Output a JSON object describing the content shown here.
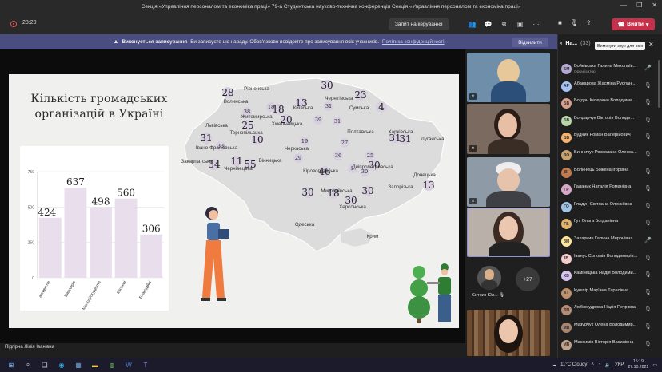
{
  "window": {
    "title": "Секція «Управління персоналом та економіка праці» 79-а Студентська науково-технічна конференція Секція «Управління персоналом та економіка праці»"
  },
  "meeting": {
    "timer": "28:20",
    "request_control_label": "Запит на керування",
    "leave_label": "Вийти"
  },
  "banner": {
    "bold": "Виконується записування",
    "text": "Ви записуєте цю нараду. Обов'язково повідомте про записування всіх учасників.",
    "link": "Політика конфіденційності",
    "dismiss_label": "Відхилити"
  },
  "slide": {
    "title": "Кількість громадських організацій в Україні"
  },
  "chart_data": {
    "type": "bar",
    "categories": [
      "активістів",
      "Школярів",
      "Молоді/студентів",
      "Місцеві",
      "Благодійні"
    ],
    "values": [
      424,
      637,
      498,
      560,
      306
    ],
    "ylim": [
      0,
      750
    ],
    "yticks": [
      "0",
      "250",
      "500",
      "750"
    ],
    "colors": {
      "bar": "#e8deec",
      "axis": "#555555"
    }
  },
  "map": {
    "regions": [
      {
        "name": "Рівненська",
        "value": ""
      },
      {
        "name": "Волинська",
        "value": "28"
      },
      {
        "name": "Чернігівська",
        "value": "30"
      },
      {
        "name": "Сумська",
        "value": "23"
      },
      {
        "name": "Житомирська",
        "value": "18"
      },
      {
        "name": "Київська",
        "value": "13"
      },
      {
        "name": "Львівська",
        "value": "31"
      },
      {
        "name": "Тернопільська",
        "value": "25"
      },
      {
        "name": "Хмельницька",
        "value": "20"
      },
      {
        "name": "Полтавська",
        "value": "31"
      },
      {
        "name": "Харківська",
        "value": "31"
      },
      {
        "name": "Луганська",
        "value": "4"
      },
      {
        "name": "Івано-Франківська",
        "value": "31"
      },
      {
        "name": "Черкаська",
        "value": "10"
      },
      {
        "name": "Вінницька",
        "value": "55"
      },
      {
        "name": "Закарпатська",
        "value": "34"
      },
      {
        "name": "Чернівецька",
        "value": "11"
      },
      {
        "name": "Кіровоградська",
        "value": "46"
      },
      {
        "name": "Дніпропетровська",
        "value": "30"
      },
      {
        "name": "Донецька",
        "value": "13"
      },
      {
        "name": "Миколаївська",
        "value": "18"
      },
      {
        "name": "Запорізька",
        "value": "30"
      },
      {
        "name": "Херсонська",
        "value": "30"
      },
      {
        "name": "Одеська",
        "value": "30"
      },
      {
        "name": "Крим",
        "value": ""
      }
    ],
    "extra_values": [
      "38",
      "18",
      "31",
      "39",
      "31",
      "33",
      "19",
      "29",
      "27",
      "36",
      "25",
      "5",
      "30"
    ]
  },
  "speaker": {
    "name": "Підгірна Лілія Іванівна"
  },
  "videos": {
    "overflow_name": "Ситник Юл...",
    "more_count": "+27"
  },
  "participants": {
    "header": "На...",
    "count": "(33)",
    "mute_all_label": "Вимкнути звук для всіх",
    "organizer_role": "Організатор",
    "list": [
      {
        "initials": "БМ",
        "name": "Бойківська Галина Миколаїв...",
        "color": "#b4a7d6",
        "mic": "🎤"
      },
      {
        "initials": "АР",
        "name": "Абакарова Жасміна Руслані...",
        "color": "#a4c2f4",
        "mic": "🎙"
      },
      {
        "initials": "БВ",
        "name": "Богдан Катерина Володими...",
        "color": "#d9a08b",
        "mic": "🎙"
      },
      {
        "initials": "БВ",
        "name": "Бондарчук Вікторія Володи...",
        "color": "#b6d7a8",
        "mic": "🎙"
      },
      {
        "initials": "БВ",
        "name": "Будник Роман Валерійович",
        "color": "#f6b26b",
        "mic": "🎙"
      },
      {
        "initials": "ВО",
        "name": "Винничук Роксолана Олекса...",
        "color": "#c9a26b",
        "mic": "🎙"
      },
      {
        "initials": "ВІ",
        "name": "Волинець Божена Ігорівна",
        "color": "#c47a4a",
        "mic": "🎙"
      },
      {
        "initials": "ГР",
        "name": "Галаник Наталія Романівна",
        "color": "#d9a7c7",
        "mic": "🎙"
      },
      {
        "initials": "ГО",
        "name": "Гладун Світлана Олексіївна",
        "color": "#9fc5e8",
        "mic": "🎙"
      },
      {
        "initials": "ГБ",
        "name": "Гут Ольга Богданівна",
        "color": "#e0b36b",
        "mic": "🎙"
      },
      {
        "initials": "ЗМ",
        "name": "Захарчин Галина Миронівна",
        "color": "#ffe599",
        "mic": "🎤"
      },
      {
        "initials": "ІВ",
        "name": "Іванус Соломія Володимирів...",
        "color": "#f4cccc",
        "mic": "🎙"
      },
      {
        "initials": "КВ",
        "name": "Камінецька Надія Володими...",
        "color": "#d5c4f2",
        "mic": "🎙"
      },
      {
        "initials": "КТ",
        "name": "Кушпір Мар'яна Тарасівна",
        "color": "#c0906a",
        "mic": "🎙"
      },
      {
        "initials": "ЛП",
        "name": "Любомудрова Надія Петрівна",
        "color": "#b78c74",
        "mic": "🎙"
      },
      {
        "initials": "МВ",
        "name": "Мазурчук Олена Володимир...",
        "color": "#a98570",
        "mic": "🎙"
      },
      {
        "initials": "МВ",
        "name": "Максимів Вікторія Василівна",
        "color": "#c2a38b",
        "mic": "🎙"
      }
    ]
  },
  "taskbar": {
    "weather": "11°C  Cloudy",
    "lang": "УКР",
    "time": "15:19",
    "date": "27.10.2021"
  }
}
